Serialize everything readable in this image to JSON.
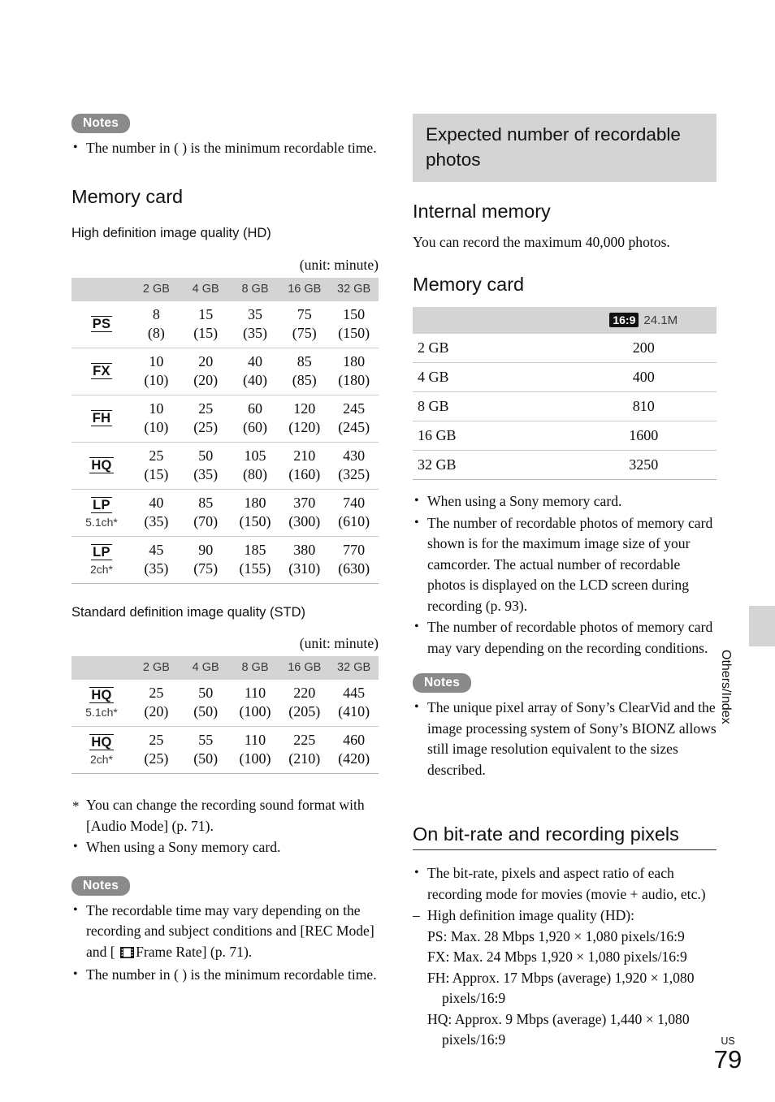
{
  "page": {
    "number": "79",
    "region_code": "US",
    "side_tab_label": "Others/Index"
  },
  "left_column": {
    "top_notes": {
      "pill_label": "Notes",
      "items": [
        "The number in ( ) is the minimum recordable time."
      ]
    },
    "memory_card_heading": "Memory card",
    "hd": {
      "subheading": "High definition image quality (HD)",
      "unit_label": "(unit: minute)",
      "columns": [
        "2 GB",
        "4 GB",
        "8 GB",
        "16 GB",
        "32 GB"
      ],
      "rows": [
        {
          "mode": "PS",
          "mode_sub": "",
          "top": [
            "8",
            "15",
            "35",
            "75",
            "150"
          ],
          "bottom": [
            "(8)",
            "(15)",
            "(35)",
            "(75)",
            "(150)"
          ]
        },
        {
          "mode": "FX",
          "mode_sub": "",
          "top": [
            "10",
            "20",
            "40",
            "85",
            "180"
          ],
          "bottom": [
            "(10)",
            "(20)",
            "(40)",
            "(85)",
            "(180)"
          ]
        },
        {
          "mode": "FH",
          "mode_sub": "",
          "top": [
            "10",
            "25",
            "60",
            "120",
            "245"
          ],
          "bottom": [
            "(10)",
            "(25)",
            "(60)",
            "(120)",
            "(245)"
          ]
        },
        {
          "mode": "HQ",
          "mode_sub": "",
          "top": [
            "25",
            "50",
            "105",
            "210",
            "430"
          ],
          "bottom": [
            "(15)",
            "(35)",
            "(80)",
            "(160)",
            "(325)"
          ]
        },
        {
          "mode": "LP",
          "mode_sub": "5.1ch*",
          "top": [
            "40",
            "85",
            "180",
            "370",
            "740"
          ],
          "bottom": [
            "(35)",
            "(70)",
            "(150)",
            "(300)",
            "(610)"
          ]
        },
        {
          "mode": "LP",
          "mode_sub": "2ch*",
          "top": [
            "45",
            "90",
            "185",
            "380",
            "770"
          ],
          "bottom": [
            "(35)",
            "(75)",
            "(155)",
            "(310)",
            "(630)"
          ]
        }
      ]
    },
    "std": {
      "subheading": "Standard definition image quality (STD)",
      "unit_label": "(unit: minute)",
      "columns": [
        "2 GB",
        "4 GB",
        "8 GB",
        "16 GB",
        "32 GB"
      ],
      "rows": [
        {
          "mode": "HQ",
          "mode_sub": "5.1ch*",
          "top": [
            "25",
            "50",
            "110",
            "220",
            "445"
          ],
          "bottom": [
            "(20)",
            "(50)",
            "(100)",
            "(205)",
            "(410)"
          ]
        },
        {
          "mode": "HQ",
          "mode_sub": "2ch*",
          "top": [
            "25",
            "55",
            "110",
            "225",
            "460"
          ],
          "bottom": [
            "(25)",
            "(50)",
            "(100)",
            "(210)",
            "(420)"
          ]
        }
      ]
    },
    "footnotes": [
      "You can change the recording sound format with [Audio Mode] (p. 71).",
      "When using a Sony memory card."
    ],
    "bottom_notes": {
      "pill_label": "Notes",
      "item_rec_time_a": "The recordable time may vary depending on the recording and subject conditions and [REC Mode] and [ ",
      "item_rec_time_b": "Frame Rate] (p. 71).",
      "item_min_time": "The number in ( ) is the minimum recordable time."
    }
  },
  "right_column": {
    "banner_title": "Expected number of recordable photos",
    "internal_memory": {
      "heading": "Internal memory",
      "body": "You can record the maximum 40,000 photos."
    },
    "memory_card": {
      "heading": "Memory card",
      "table_header_ratio": "16:9",
      "table_header_size": "24.1M",
      "rows": [
        {
          "capacity": "2 GB",
          "photos": "200"
        },
        {
          "capacity": "4 GB",
          "photos": "400"
        },
        {
          "capacity": "8 GB",
          "photos": "810"
        },
        {
          "capacity": "16 GB",
          "photos": "1600"
        },
        {
          "capacity": "32 GB",
          "photos": "3250"
        }
      ],
      "bullets": [
        "When using a Sony memory card.",
        "The number of recordable photos of memory card shown is for the maximum image size of your camcorder. The actual number of recordable photos is displayed on the LCD screen during recording (p. 93).",
        "The number of recordable photos of memory card may vary depending on the recording conditions."
      ]
    },
    "notes": {
      "pill_label": "Notes",
      "items": [
        "The unique pixel array of Sony’s ClearVid and the image processing system of Sony’s BIONZ allows still image resolution equivalent to the sizes described."
      ]
    },
    "bitrate": {
      "heading": "On bit-rate and recording pixels",
      "intro": "The bit-rate, pixels and aspect ratio of each recording mode for movies (movie + audio, etc.)",
      "hd_label": "High definition image quality (HD):",
      "modes": [
        "PS: Max. 28 Mbps 1,920 × 1,080 pixels/16:9",
        "FX: Max. 24 Mbps 1,920 × 1,080 pixels/16:9",
        "FH: Approx. 17 Mbps (average) 1,920 × 1,080",
        "pixels/16:9",
        "HQ: Approx. 9 Mbps (average) 1,440 × 1,080",
        "pixels/16:9"
      ]
    }
  }
}
